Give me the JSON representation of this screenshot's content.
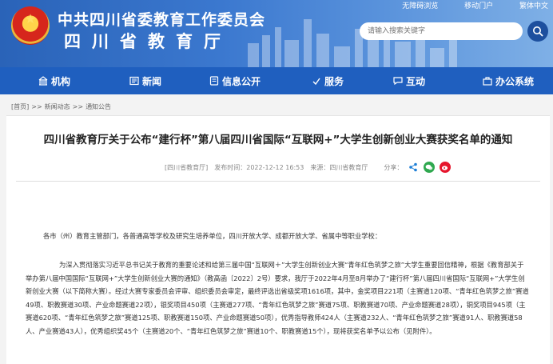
{
  "header": {
    "title": "中共四川省委教育工作委员会",
    "subtitle": "四川省教育厅",
    "top_links": [
      "无障碍浏览",
      "移动门户",
      "繁体中文"
    ],
    "search_placeholder": "请输入搜索关键字"
  },
  "nav": {
    "items": [
      {
        "label": "机构",
        "icon": "building-icon"
      },
      {
        "label": "新闻",
        "icon": "news-icon"
      },
      {
        "label": "信息公开",
        "icon": "info-icon"
      },
      {
        "label": "服务",
        "icon": "service-icon"
      },
      {
        "label": "互动",
        "icon": "chat-icon"
      },
      {
        "label": "办公系统",
        "icon": "office-icon"
      }
    ]
  },
  "breadcrumb": {
    "items": [
      "首页",
      "新闻动态",
      "通知公告"
    ],
    "separator": ">>"
  },
  "article": {
    "title": "四川省教育厅关于公布“建行杯”第八届四川省国际“互联网+”大学生创新创业大赛获奖名单的通知",
    "meta_source": "[四川省教育厅]",
    "meta_date": "发布时间：2022-12-12 16:53",
    "meta_origin": "来源：四川省教育厅",
    "meta_share": "分享：",
    "salutation": "各市（州）教育主管部门，各普通高等学校及研究生培养单位，四川开放大学、成都开放大学、省属中等职业学校：",
    "body": "为深入贯彻落实习近平总书记关于教育的重要论述和给第三届中国“互联网＋”大学生创新创业大赛“青年红色筑梦之旅”大学生重要回信精神，根据《教育部关于举办第八届中国国际“互联网+”大学生创新创业大赛的通知》（教高函〔2022〕2号）要求，我厅于2022年4月至8月举办了“建行杯”第八届四川省国际“互联网+”大学生创新创业大赛（以下简称大赛）。经过大赛专家委员会评审、组织委员会审定，最终评选出省级奖项1616项，其中，金奖项目221项（主赛道120项、“青年红色筑梦之旅”赛道49项、职教赛道30项、产业命题赛道22项），银奖项目450项（主赛道277项、“青年红色筑梦之旅”赛道75项、职教赛道70项、产业命题赛道28项），铜奖项目945项（主赛道620项、“青年红色筑梦之旅”赛道125项、职教赛道150项、产业命题赛道50项），优秀指导教师424人（主赛道232人、“青年红色筑梦之旅”赛道91人、职教赛道58人、产业赛道43人），优秀组织奖45个（主赛道20个、“青年红色筑梦之旅”赛道10个、职教赛道15个），现将获奖名单予以公布（见附件）。"
  },
  "colors": {
    "nav_bg": "#1f5fbf",
    "header_bg": "#3b78cf",
    "wechat": "#2fa84f",
    "weibo": "#e6162d",
    "share_blue": "#1f7fd6"
  }
}
